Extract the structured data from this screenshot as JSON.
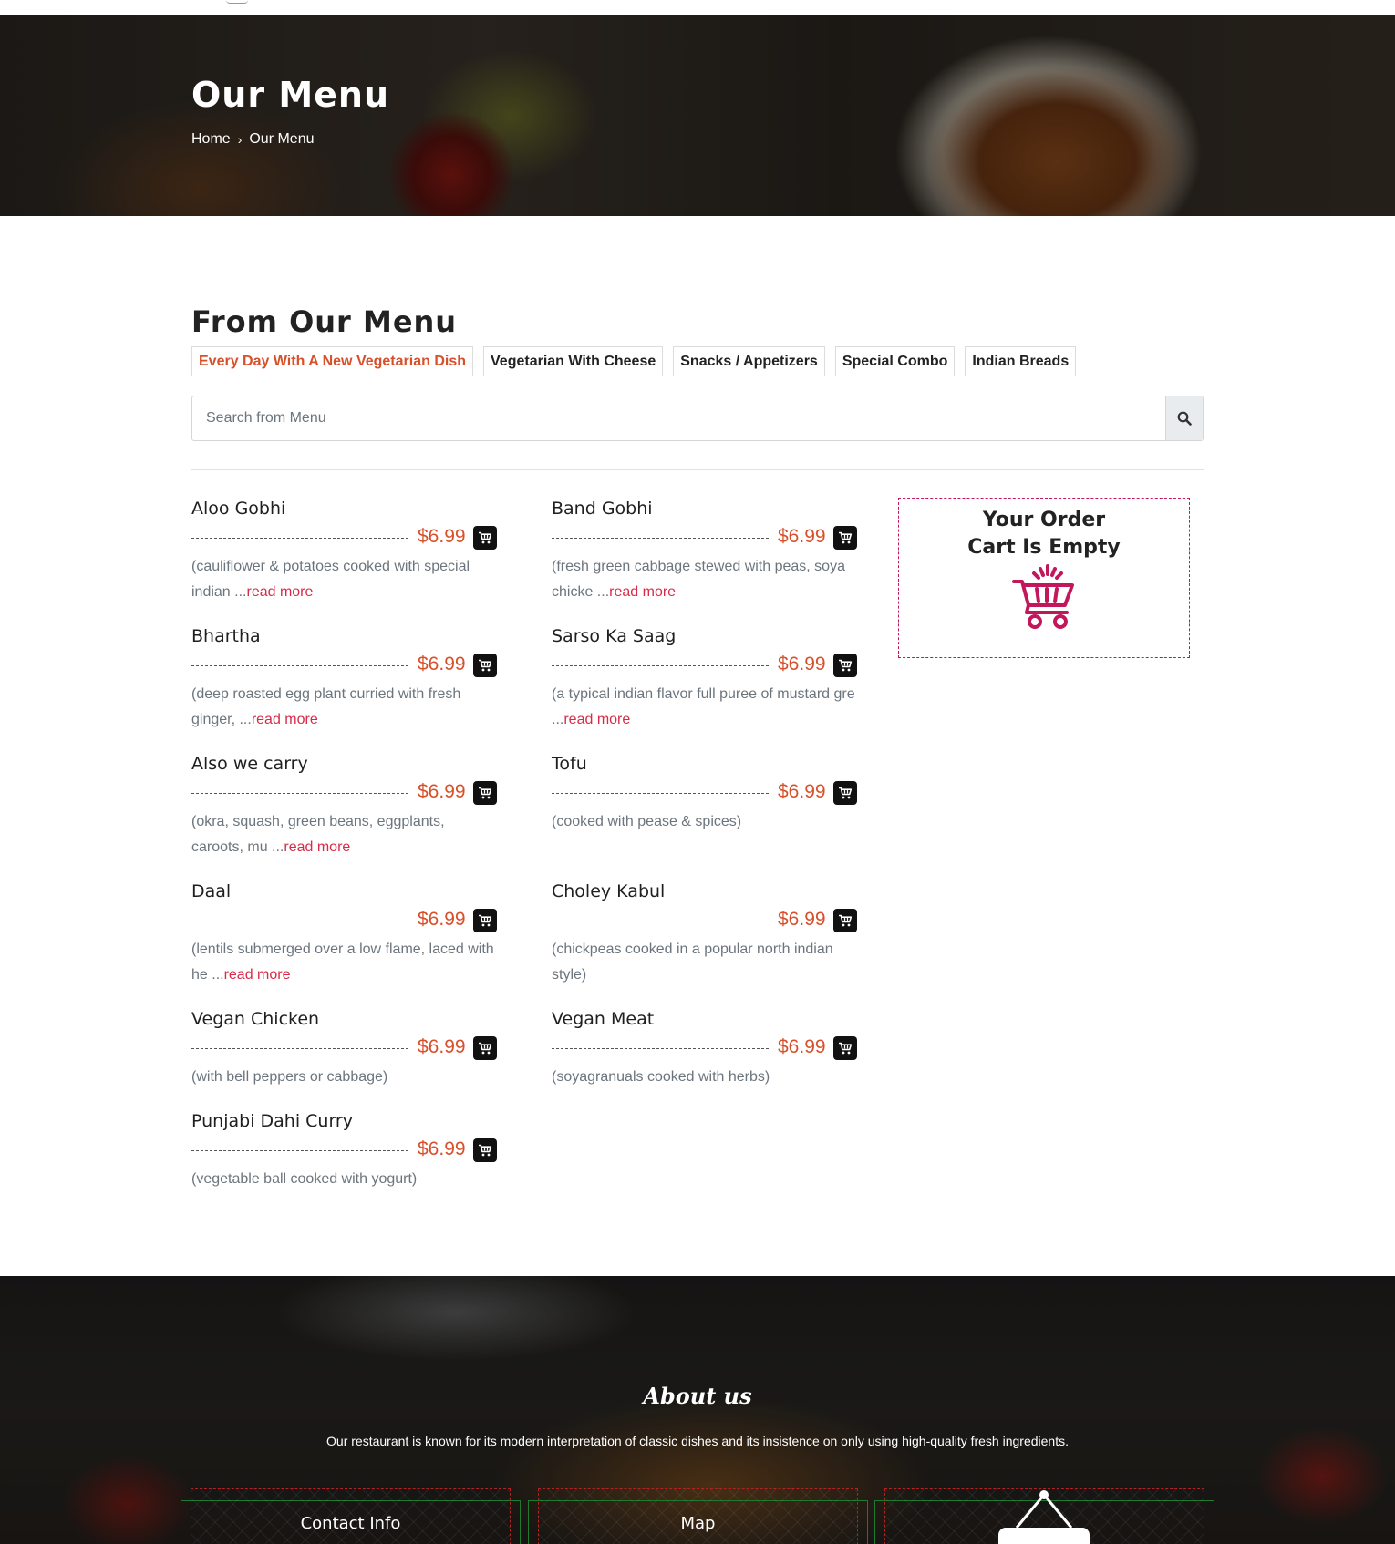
{
  "hero": {
    "title": "Our Menu",
    "breadcrumb": {
      "home": "Home",
      "separator": "›",
      "current": "Our Menu"
    }
  },
  "menu_section": {
    "title": "From Our Menu",
    "tabs": [
      {
        "label": "Every Day With A New Vegetarian Dish",
        "active": true
      },
      {
        "label": "Vegetarian With Cheese",
        "active": false
      },
      {
        "label": "Snacks / Appetizers",
        "active": false
      },
      {
        "label": "Special Combo",
        "active": false
      },
      {
        "label": "Indian Breads",
        "active": false
      }
    ],
    "search": {
      "placeholder": "Search from Menu",
      "value": "",
      "icon": "search-icon"
    },
    "items": [
      {
        "name": "Aloo Gobhi",
        "price": "$6.99",
        "desc": "(cauliflower & potatoes cooked with special indian ...",
        "more": "read more"
      },
      {
        "name": "Band Gobhi",
        "price": "$6.99",
        "desc": "(fresh green cabbage stewed with peas, soya chicke ...",
        "more": "read more"
      },
      {
        "name": "Bhartha",
        "price": "$6.99",
        "desc": "(deep roasted egg plant curried with fresh ginger, ...",
        "more": "read more"
      },
      {
        "name": "Sarso Ka Saag",
        "price": "$6.99",
        "desc": "(a typical indian flavor full puree of mustard gre ...",
        "more": "read more"
      },
      {
        "name": "Also we carry",
        "price": "$6.99",
        "desc": "(okra, squash, green beans, eggplants, caroots, mu ...",
        "more": "read more"
      },
      {
        "name": "Tofu",
        "price": "$6.99",
        "desc": "(cooked with pease & spices)",
        "more": ""
      },
      {
        "name": "Daal",
        "price": "$6.99",
        "desc": "(lentils submerged over a low flame, laced with he ...",
        "more": "read more"
      },
      {
        "name": "Choley Kabul",
        "price": "$6.99",
        "desc": "(chickpeas cooked in a popular north indian style)",
        "more": ""
      },
      {
        "name": "Vegan Chicken",
        "price": "$6.99",
        "desc": "(with bell peppers or cabbage)",
        "more": ""
      },
      {
        "name": "Vegan Meat",
        "price": "$6.99",
        "desc": "(soyagranuals cooked with herbs)",
        "more": ""
      },
      {
        "name": "Punjabi Dahi Curry",
        "price": "$6.99",
        "desc": "(vegetable ball cooked with yogurt)",
        "more": ""
      }
    ]
  },
  "cart": {
    "line1": "Your Order",
    "line2": "Cart Is Empty",
    "icon": "empty-cart-icon"
  },
  "footer": {
    "about_title": "About us",
    "about_text": "Our restaurant is known for its modern interpretation of classic dishes and its insistence on only using high-quality fresh ingredients.",
    "boxes": [
      {
        "title": "Contact Info"
      },
      {
        "title": "Map"
      },
      {
        "title": ""
      }
    ]
  },
  "colors": {
    "accent": "#d8502a",
    "read_more": "#d72c49",
    "cart_pink": "#c2185b",
    "text_muted": "#6c757d"
  }
}
